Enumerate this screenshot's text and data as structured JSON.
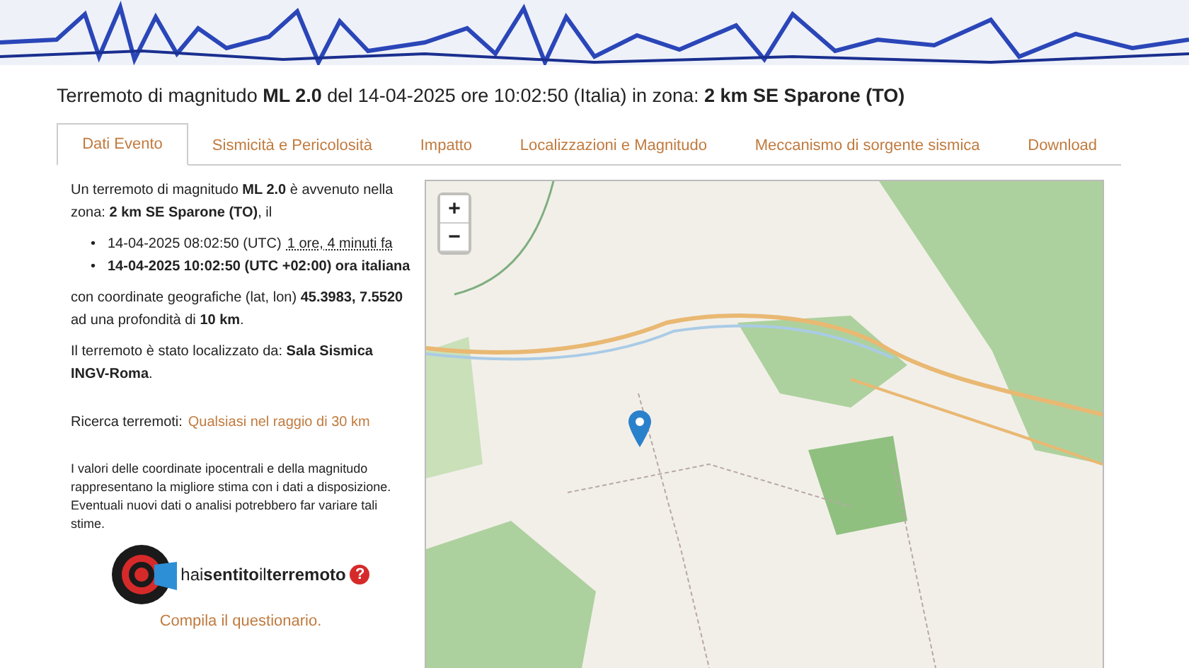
{
  "title": "Terremoto di magnitudo **ML 2.0** del 14-04-2025 ore 10:02:50 (Italia) in zona: **2 km SE Sparone (TO)**",
  "tabs": [
    {
      "label": "Dati Evento",
      "selected": true
    },
    {
      "label": "Sismicità e Pericolosità",
      "selected": false
    },
    {
      "label": "Impatto",
      "selected": false
    },
    {
      "label": "Localizzazioni e Magnitudo",
      "selected": false
    },
    {
      "label": "Meccanismo di sorgente sismica",
      "selected": false
    },
    {
      "label": "Download",
      "selected": false
    }
  ],
  "summary": {
    "intro": "Un terremoto di magnitudo **ML 2.0** è avvenuto nella zona: **2 km SE Sparone (TO)**, il",
    "times": [
      {
        "marker": "•",
        "text": "14-04-2025 08:02:50 (UTC)",
        "relative": "1 ore, 4 minuti fa",
        "bold": false
      },
      {
        "marker": "•",
        "text": "14-04-2025 10:02:50 (UTC +02:00) ora italiana",
        "bold": true
      }
    ],
    "coordinates": "con coordinate geografiche (lat, lon) **45.3983, 7.5520** ad una profondità di **10 km**.",
    "located": "Il terremoto è stato localizzato da: **Sala Sismica INGV-Roma**."
  },
  "search": {
    "label": "Ricerca terremoti:",
    "link": "Qualsiasi nel raggio di 30 km"
  },
  "disclaimer": "I valori delle coordinate ipocentrali e della magnitudo rappresentano la migliore stima con i dati a disposizione. Eventuali nuovi dati o analisi potrebbero far variare tali stime.",
  "questionnaire": {
    "logo_text": "hai**sentito**il**terremoto**",
    "help": "?",
    "link": "Compila il questionario."
  },
  "map": {
    "zoom_in": "+",
    "zoom_out": "−"
  }
}
